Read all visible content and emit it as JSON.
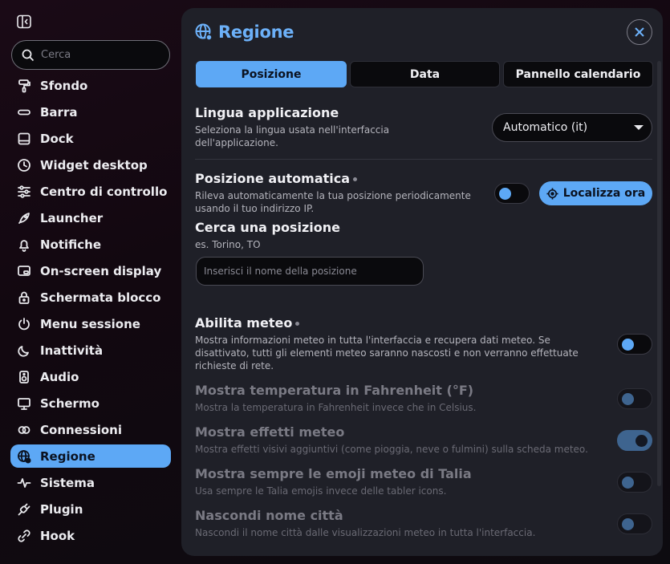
{
  "sidebar": {
    "search_placeholder": "Cerca",
    "items": [
      {
        "label": "Sfondo",
        "icon": "paint-roller-icon"
      },
      {
        "label": "Barra",
        "icon": "bar-icon"
      },
      {
        "label": "Dock",
        "icon": "dock-icon"
      },
      {
        "label": "Widget desktop",
        "icon": "clock-icon"
      },
      {
        "label": "Centro di controllo",
        "icon": "sliders-icon"
      },
      {
        "label": "Launcher",
        "icon": "rocket-icon"
      },
      {
        "label": "Notifiche",
        "icon": "bell-icon"
      },
      {
        "label": "On-screen display",
        "icon": "osd-icon"
      },
      {
        "label": "Schermata blocco",
        "icon": "lock-icon"
      },
      {
        "label": "Menu sessione",
        "icon": "power-icon"
      },
      {
        "label": "Inattività",
        "icon": "moon-icon"
      },
      {
        "label": "Audio",
        "icon": "speaker-icon"
      },
      {
        "label": "Schermo",
        "icon": "monitor-icon"
      },
      {
        "label": "Connessioni",
        "icon": "link-icon"
      },
      {
        "label": "Regione",
        "icon": "globe-icon",
        "active": true
      },
      {
        "label": "Sistema",
        "icon": "activity-icon"
      },
      {
        "label": "Plugin",
        "icon": "plug-icon"
      },
      {
        "label": "Hook",
        "icon": "hook-icon"
      }
    ]
  },
  "panel": {
    "title": "Regione",
    "tabs": [
      {
        "label": "Posizione",
        "active": true
      },
      {
        "label": "Data",
        "active": false
      },
      {
        "label": "Pannello calendario",
        "active": false
      }
    ]
  },
  "language": {
    "title": "Lingua applicazione",
    "desc": "Seleziona la lingua usata nell'interfaccia dell'applicazione.",
    "value": "Automatico (it)"
  },
  "auto_location": {
    "title": "Posizione automatica",
    "desc": "Rileva automaticamente la tua posizione periodicamente usando il tuo indirizzo IP.",
    "enabled": false,
    "button_label": "Localizza ora"
  },
  "search_location": {
    "title": "Cerca una posizione",
    "example": "es. Torino, TO",
    "placeholder": "Inserisci il nome della posizione"
  },
  "weather": {
    "title": "Abilita meteo",
    "desc": "Mostra informazioni meteo in tutta l'interfaccia e recupera dati meteo. Se disattivato, tutti gli elementi meteo saranno nascosti e non verranno effettuate richieste di rete.",
    "enabled": false
  },
  "fahrenheit": {
    "title": "Mostra temperatura in Fahrenheit (°F)",
    "desc": "Mostra la temperatura in Fahrenheit invece che in Celsius.",
    "enabled": false
  },
  "effects": {
    "title": "Mostra effetti meteo",
    "desc": "Mostra effetti visivi aggiuntivi (come pioggia, neve o fulmini) sulla scheda meteo.",
    "enabled": true
  },
  "emoji": {
    "title": "Mostra sempre le emoji meteo di Talia",
    "desc": "Usa sempre le Talia emojis invece delle tabler icons.",
    "enabled": false
  },
  "hide_city": {
    "title": "Nascondi nome città",
    "desc": "Nascondi il nome città dalle visualizzazioni meteo in tutta l'interfaccia.",
    "enabled": false
  },
  "colors": {
    "accent": "#5da8f5",
    "panel": "#1f2028",
    "field": "#0a0a0d"
  }
}
